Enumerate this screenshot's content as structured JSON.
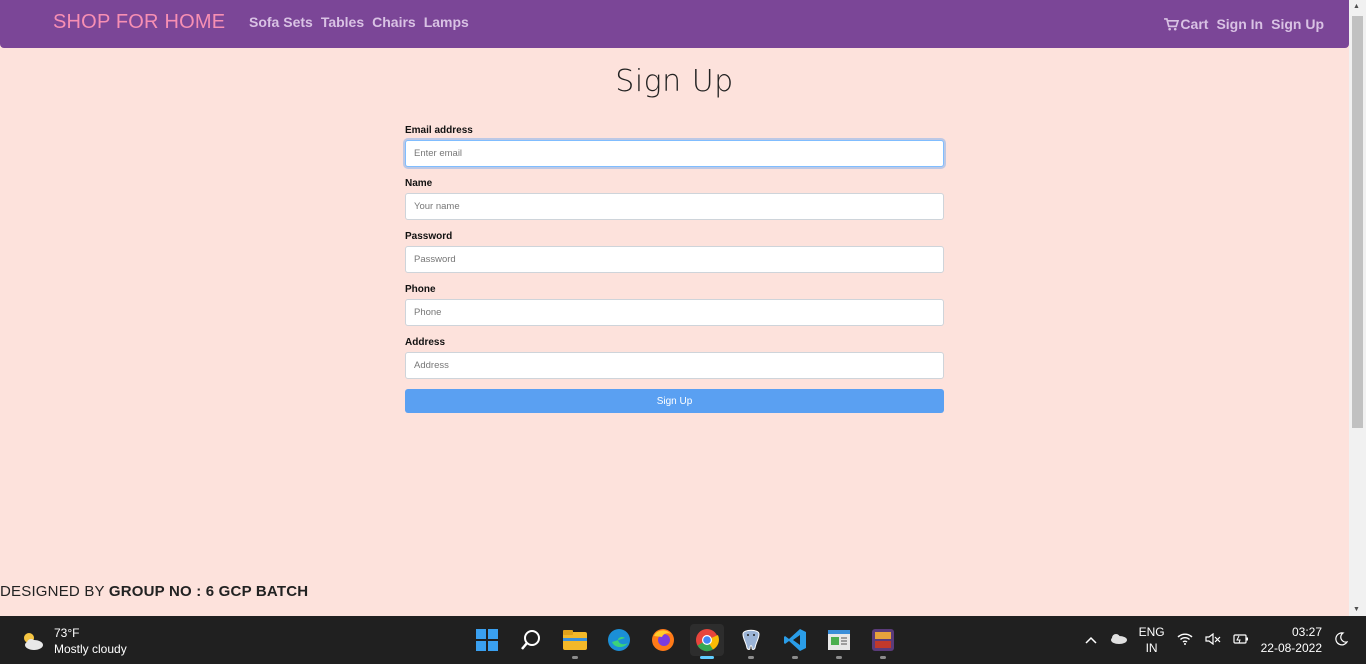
{
  "navbar": {
    "brand": "SHOP FOR HOME",
    "links": [
      "Sofa Sets",
      "Tables",
      "Chairs",
      "Lamps"
    ],
    "cart": "Cart",
    "sign_in": "Sign In",
    "sign_up": "Sign Up"
  },
  "page": {
    "title": "Sign Up"
  },
  "form": {
    "email": {
      "label": "Email address",
      "placeholder": "Enter email",
      "value": ""
    },
    "name": {
      "label": "Name",
      "placeholder": "Your name",
      "value": ""
    },
    "password": {
      "label": "Password",
      "placeholder": "Password",
      "value": ""
    },
    "phone": {
      "label": "Phone",
      "placeholder": "Phone",
      "value": ""
    },
    "address": {
      "label": "Address",
      "placeholder": "Address",
      "value": ""
    },
    "submit": "Sign Up"
  },
  "footer": {
    "prefix": "DESIGNED BY",
    "group": "GROUP NO : 6 GCP BATCH"
  },
  "taskbar": {
    "weather": {
      "temp": "73°F",
      "condition": "Mostly cloudy",
      "icon": "cloud-sun-icon"
    },
    "apps": [
      "start-icon",
      "search-icon",
      "file-explorer-icon",
      "edge-icon",
      "firefox-icon",
      "chrome-icon",
      "postgresql-icon",
      "vscode-icon",
      "notepad-icon",
      "app-icon"
    ],
    "tray": {
      "lang": "ENG",
      "region": "IN",
      "time": "03:27",
      "date": "22-08-2022"
    }
  },
  "colors": {
    "navbar": "#7b4697",
    "brand": "#f78fb3",
    "background": "#fde2dc",
    "button": "#5aa0f2"
  }
}
